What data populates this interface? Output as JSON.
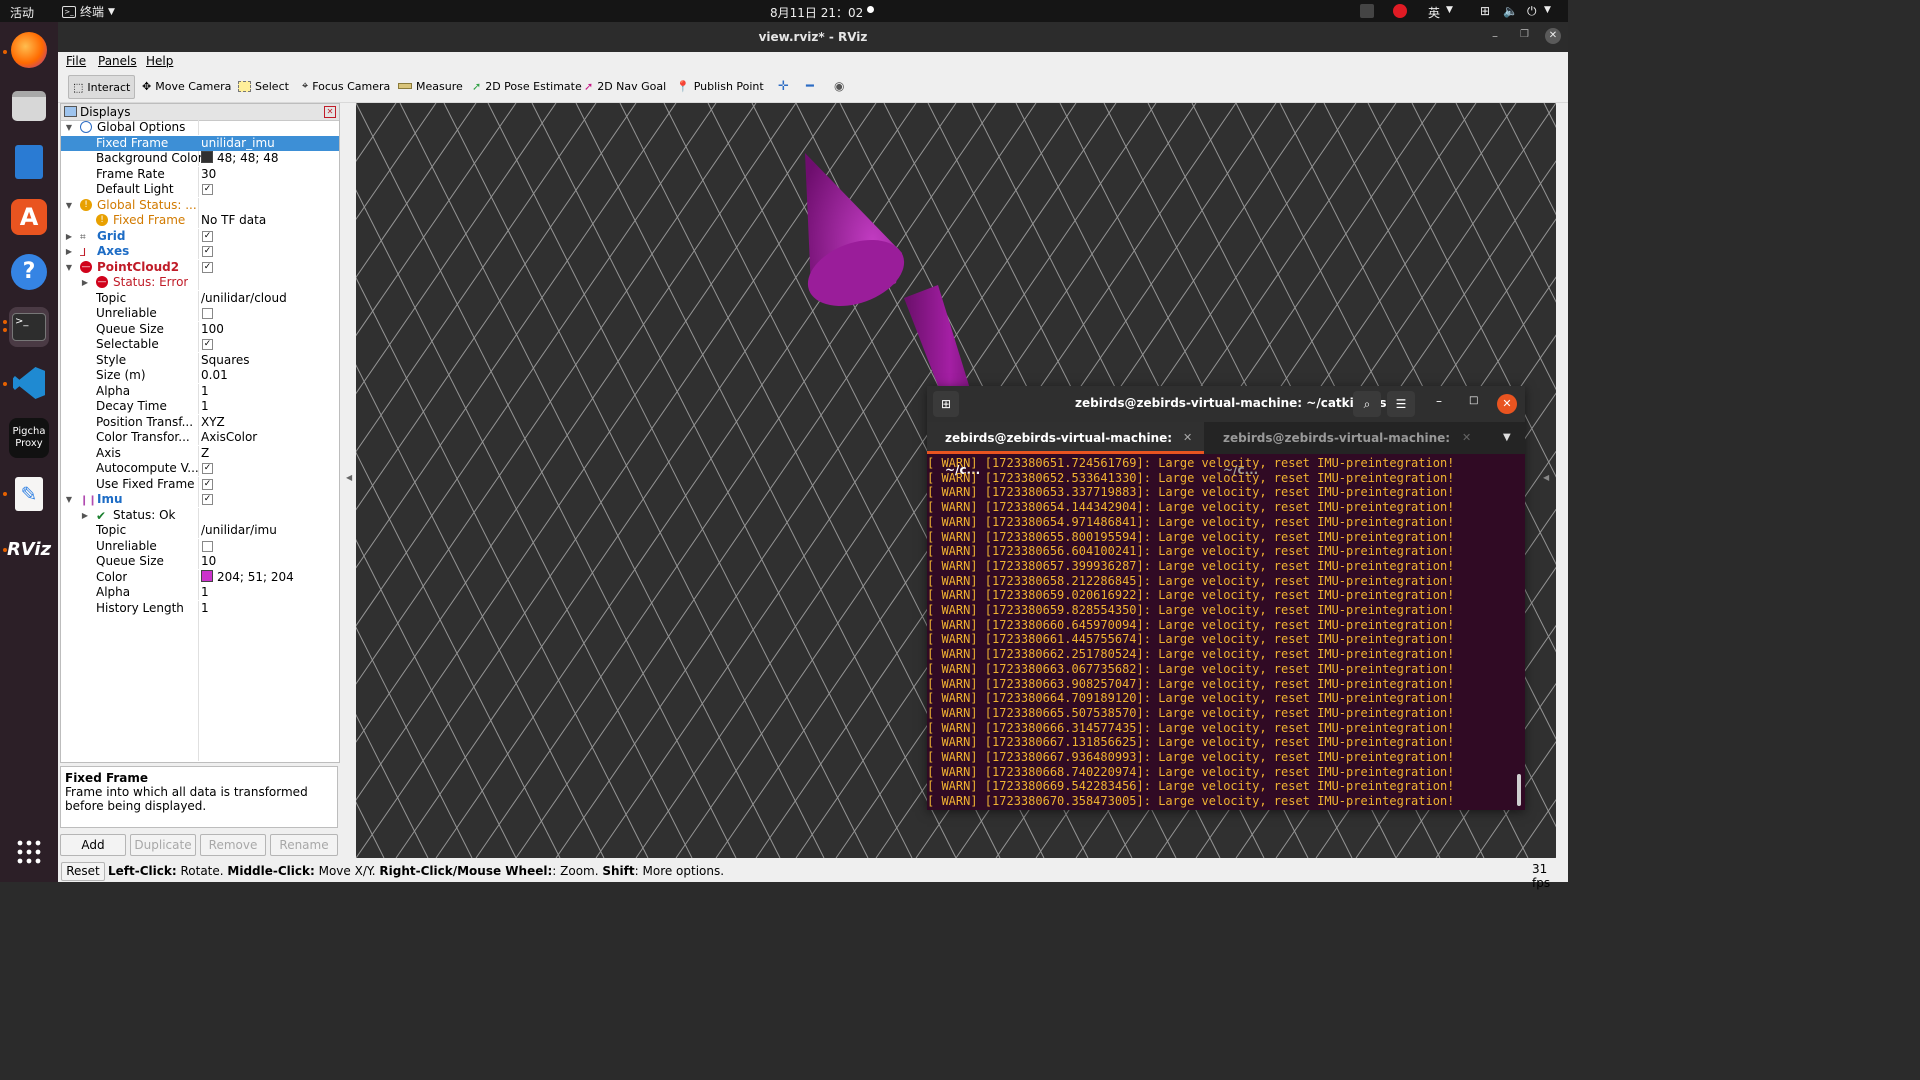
{
  "topbar": {
    "activities": "活动",
    "app_menu": "终端",
    "clock": "8月11日  21：02",
    "input_method": "英"
  },
  "dock": {
    "items": [
      "firefox",
      "files",
      "libreoffice-writer",
      "ubuntu-software",
      "help",
      "terminal",
      "vscode",
      "pigcha-proxy",
      "text-editor",
      "rviz",
      "show-apps"
    ],
    "pigcha_label_1": "Pigcha",
    "pigcha_label_2": "Proxy",
    "rviz_label": "RViz"
  },
  "window": {
    "title": "view.rviz* - RViz"
  },
  "menubar": {
    "file": "File",
    "panels": "Panels",
    "help": "Help"
  },
  "toolbar": {
    "interact": "Interact",
    "move_camera": "Move Camera",
    "select": "Select",
    "focus_camera": "Focus Camera",
    "measure": "Measure",
    "pose_estimate": "2D Pose Estimate",
    "nav_goal": "2D Nav Goal",
    "publish_point": "Publish Point"
  },
  "displays": {
    "header": "Displays",
    "rows": [
      {
        "name": "Global Options",
        "value": ""
      },
      {
        "name": "Fixed Frame",
        "value": "unilidar_imu"
      },
      {
        "name": "Background Color",
        "value": "48; 48; 48"
      },
      {
        "name": "Frame Rate",
        "value": "30"
      },
      {
        "name": "Default Light",
        "value": ""
      },
      {
        "name": "Global Status: ...",
        "value": ""
      },
      {
        "name": "Fixed Frame",
        "value": "No TF data"
      },
      {
        "name": "Grid",
        "value": ""
      },
      {
        "name": "Axes",
        "value": ""
      },
      {
        "name": "PointCloud2",
        "value": ""
      },
      {
        "name": "Status: Error",
        "value": ""
      },
      {
        "name": "Topic",
        "value": "/unilidar/cloud"
      },
      {
        "name": "Unreliable",
        "value": ""
      },
      {
        "name": "Queue Size",
        "value": "100"
      },
      {
        "name": "Selectable",
        "value": ""
      },
      {
        "name": "Style",
        "value": "Squares"
      },
      {
        "name": "Size (m)",
        "value": "0.01"
      },
      {
        "name": "Alpha",
        "value": "1"
      },
      {
        "name": "Decay Time",
        "value": "1"
      },
      {
        "name": "Position Transf...",
        "value": "XYZ"
      },
      {
        "name": "Color Transfor...",
        "value": "AxisColor"
      },
      {
        "name": "Axis",
        "value": "Z"
      },
      {
        "name": "Autocompute V...",
        "value": ""
      },
      {
        "name": "Use Fixed Frame",
        "value": ""
      },
      {
        "name": "Imu",
        "value": ""
      },
      {
        "name": "Status: Ok",
        "value": ""
      },
      {
        "name": "Topic",
        "value": "/unilidar/imu"
      },
      {
        "name": "Unreliable",
        "value": ""
      },
      {
        "name": "Queue Size",
        "value": "10"
      },
      {
        "name": "Color",
        "value": "204; 51; 204"
      },
      {
        "name": "Alpha",
        "value": "1"
      },
      {
        "name": "History Length",
        "value": "1"
      }
    ],
    "checkboxes": {
      "default_light": true,
      "grid": true,
      "axes": true,
      "pointcloud2": true,
      "pc_unreliable": false,
      "pc_selectable": true,
      "pc_autocompute": true,
      "pc_use_fixed_frame": true,
      "imu": true,
      "imu_unreliable": false
    },
    "description_title": "Fixed Frame",
    "description_text": "Frame into which all data is transformed before being displayed."
  },
  "buttons": {
    "add": "Add",
    "duplicate": "Duplicate",
    "remove": "Remove",
    "rename": "Rename",
    "reset": "Reset"
  },
  "statusbar": {
    "left_click": "Left-Click:",
    "left_click_desc": " Rotate. ",
    "middle_click": "Middle-Click:",
    "middle_click_desc": " Move X/Y. ",
    "right_click": "Right-Click/Mouse Wheel:",
    "right_click_desc": ": Zoom. ",
    "shift": "Shift",
    "shift_desc": ": More options.",
    "fps": "31 fps"
  },
  "terminal": {
    "title": "zebirds@zebirds-virtual-machine: ~/catkin_ws",
    "tab1": "zebirds@zebirds-virtual-machine: ~/c...",
    "tab2": "zebirds@zebirds-virtual-machine: ~/c...",
    "lines": [
      "[ WARN] [1723380651.724561769]: Large velocity, reset IMU-preintegration!",
      "[ WARN] [1723380652.533641330]: Large velocity, reset IMU-preintegration!",
      "[ WARN] [1723380653.337719883]: Large velocity, reset IMU-preintegration!",
      "[ WARN] [1723380654.144342904]: Large velocity, reset IMU-preintegration!",
      "[ WARN] [1723380654.971486841]: Large velocity, reset IMU-preintegration!",
      "[ WARN] [1723380655.800195594]: Large velocity, reset IMU-preintegration!",
      "[ WARN] [1723380656.604100241]: Large velocity, reset IMU-preintegration!",
      "[ WARN] [1723380657.399936287]: Large velocity, reset IMU-preintegration!",
      "[ WARN] [1723380658.212286845]: Large velocity, reset IMU-preintegration!",
      "[ WARN] [1723380659.020616922]: Large velocity, reset IMU-preintegration!",
      "[ WARN] [1723380659.828554350]: Large velocity, reset IMU-preintegration!",
      "[ WARN] [1723380660.645970094]: Large velocity, reset IMU-preintegration!",
      "[ WARN] [1723380661.445755674]: Large velocity, reset IMU-preintegration!",
      "[ WARN] [1723380662.251780524]: Large velocity, reset IMU-preintegration!",
      "[ WARN] [1723380663.067735682]: Large velocity, reset IMU-preintegration!",
      "[ WARN] [1723380663.908257047]: Large velocity, reset IMU-preintegration!",
      "[ WARN] [1723380664.709189120]: Large velocity, reset IMU-preintegration!",
      "[ WARN] [1723380665.507538570]: Large velocity, reset IMU-preintegration!",
      "[ WARN] [1723380666.314577435]: Large velocity, reset IMU-preintegration!",
      "[ WARN] [1723380667.131856625]: Large velocity, reset IMU-preintegration!",
      "[ WARN] [1723380667.936480993]: Large velocity, reset IMU-preintegration!",
      "[ WARN] [1723380668.740220974]: Large velocity, reset IMU-preintegration!",
      "[ WARN] [1723380669.542283456]: Large velocity, reset IMU-preintegration!",
      "[ WARN] [1723380670.358473005]: Large velocity, reset IMU-preintegration!"
    ]
  },
  "colors": {
    "background": "#303030",
    "grid": "#a0a0a0",
    "imu_arrow": "#cc33cc",
    "terminal_bg": "#300a24",
    "warn_text": "#f0b232",
    "selection": "#3d8fd6"
  }
}
